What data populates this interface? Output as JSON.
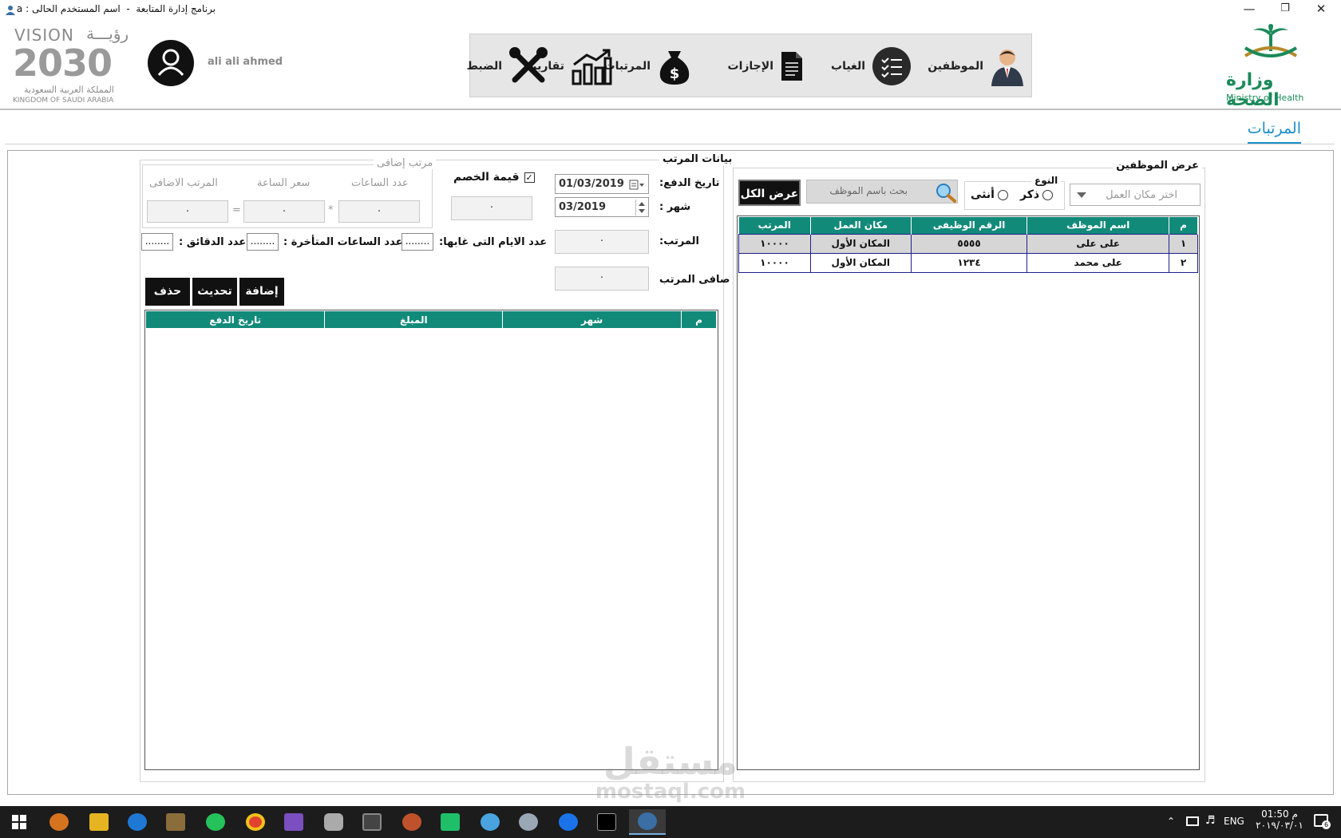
{
  "titlebar": {
    "user_label": "اسم المستخدم الحالى",
    "separator": ":",
    "user_value": "a",
    "dash": "-",
    "app_title": "برنامج إدارة المتابعة"
  },
  "header": {
    "vision": {
      "top": "VISION",
      "arabic": "رؤيـــة",
      "year": "2030",
      "kingdom_ar": "المملكة العربية السعودية",
      "kingdom_en": "KINGDOM OF SAUDI ARABIA"
    },
    "username": "ali ali ahmed",
    "ministry_ar": "وزارة الصحة",
    "ministry_en": "Ministry of Health"
  },
  "toolbar": {
    "items": [
      {
        "label": "الموظفين",
        "icon": "employee-icon"
      },
      {
        "label": "الغياب",
        "icon": "checklist-icon"
      },
      {
        "label": "الإجازات",
        "icon": "document-icon"
      },
      {
        "label": "المرتبات",
        "icon": "money-bag-icon"
      },
      {
        "label": "تقارير",
        "icon": "chart-icon"
      },
      {
        "label": "الضبط",
        "icon": "tools-icon"
      }
    ]
  },
  "page": {
    "tab_title": "المرتبات"
  },
  "employees_panel": {
    "title": "عرض الموظفين",
    "work_place_placeholder": "اختر مكان العمل",
    "gender_title": "النوع",
    "gender_male": "ذكر",
    "gender_female": "أنثى",
    "search_placeholder": "بحث باسم الموظف",
    "show_all": "عرض الكل",
    "columns": [
      "م",
      "اسم الموظف",
      "الرقم الوظيفى",
      "مكان العمل",
      "المرتب"
    ],
    "rows": [
      [
        "١",
        "على على",
        "٥٥٥٥",
        "المكان الأول",
        "١٠٠٠٠"
      ],
      [
        "٢",
        "على محمد",
        "١٢٣٤",
        "المكان الأول",
        "١٠٠٠٠"
      ]
    ]
  },
  "salary_panel": {
    "title": "بيانات المرتب",
    "pay_date_label": "تاريخ الدفع:",
    "pay_date_value": "01/03/2019",
    "month_label": "شهر :",
    "month_value": "03/2019",
    "salary_label": "المرتب:",
    "salary_value": "٠",
    "net_label": "صافى المرتب",
    "net_value": "٠",
    "discount_label": "قيمة الخصم",
    "discount_checked": true,
    "discount_value": "٠",
    "extra_title": "مرتب إضافى",
    "hours_label": "عدد الساعات",
    "hour_rate_label": "سعر الساعة",
    "extra_salary_label": "المرتب الاضافى",
    "hours_value": "٠",
    "hour_rate_value": "٠",
    "extra_value": "٠",
    "mult_sign": "*",
    "eq_sign": "=",
    "absent_days_label": "عدد الايام التى غابها:",
    "late_hours_label": "عدد الساعات المتأخرة :",
    "minutes_label": "عدد الدقائق :",
    "dots": "........",
    "add": "إضافة",
    "update": "تحديث",
    "delete": "حذف",
    "columns": [
      "م",
      "شهر",
      "المبلغ",
      "تاريخ الدفع"
    ]
  },
  "watermark": {
    "ar": "مستقل",
    "en": "mostaql.com"
  },
  "taskbar": {
    "lang": "ENG",
    "time": "01:50 م",
    "date": "٢٠١٩/٠٣/٠١",
    "notifications": "6"
  }
}
